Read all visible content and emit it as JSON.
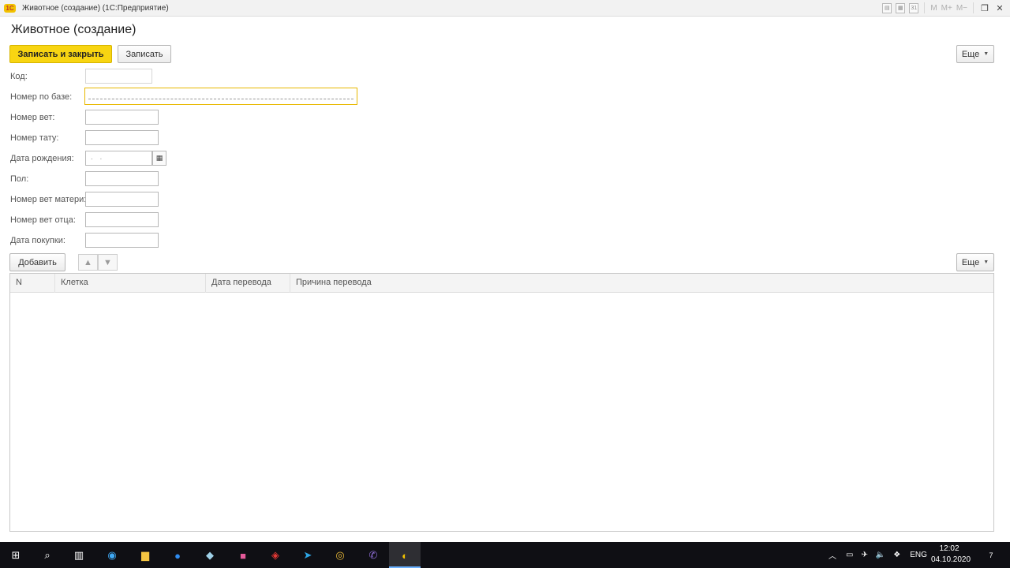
{
  "window": {
    "title": "Животное (создание)  (1С:Предприятие)",
    "logo": "1С"
  },
  "titlebar_tools": {
    "m": "M",
    "m_plus": "M+",
    "m_minus": "M−"
  },
  "form": {
    "title": "Животное (создание)",
    "save_close_label": "Записать и закрыть",
    "save_label": "Записать",
    "more_label": "Еще"
  },
  "fields": {
    "code": {
      "label": "Код:",
      "value": ""
    },
    "base_number": {
      "label": "Номер по базе:",
      "value": ""
    },
    "vet_number": {
      "label": "Номер вет:",
      "value": ""
    },
    "tattoo_number": {
      "label": "Номер тату:",
      "value": ""
    },
    "birth_date": {
      "label": "Дата рождения:",
      "value": ". ."
    },
    "sex": {
      "label": "Пол:",
      "value": ""
    },
    "mother_vet": {
      "label": "Номер вет матери:",
      "value": ""
    },
    "father_vet": {
      "label": "Номер вет отца:",
      "value": ""
    },
    "purchase_date": {
      "label": "Дата покупки:",
      "value": ""
    }
  },
  "table_toolbar": {
    "add_label": "Добавить",
    "more_label": "Еще"
  },
  "table": {
    "columns": [
      "N",
      "Клетка",
      "Дата перевода",
      "Причина перевода"
    ],
    "rows": []
  },
  "taskbar": {
    "lang": "ENG",
    "time": "12:02",
    "date": "04.10.2020",
    "notifications": "7"
  },
  "colors": {
    "primary_button": "#f8d512",
    "focus_border": "#e8b800",
    "taskbar": "#0f0f14"
  }
}
